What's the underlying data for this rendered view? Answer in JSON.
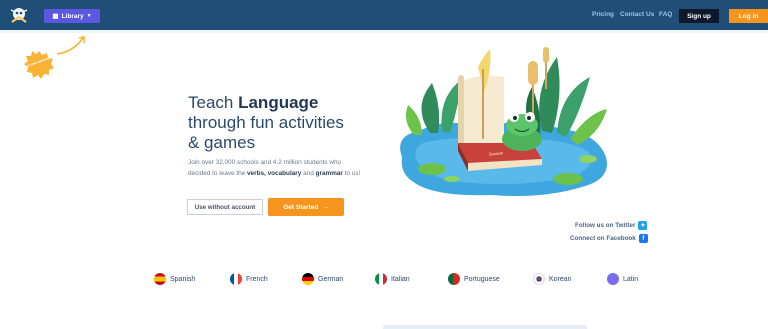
{
  "nav": {
    "library_label": "Library",
    "links": [
      "Pricing",
      "Contact Us",
      "FAQ"
    ],
    "signup_label": "Sign up",
    "login_label": "Log in"
  },
  "badge": {
    "text": "it's a new adventure"
  },
  "hero": {
    "title_pre": "Teach ",
    "title_bold": "Language",
    "title_line2": "through fun activities",
    "title_line3": "& games",
    "sub_part1": "Join over 32,000 schools and 4.2 million students who",
    "sub_part2": "decided to leave the ",
    "sub_verbs": "verbs, vocabulary",
    "sub_and": " and ",
    "sub_grammar": "grammar",
    "sub_end": " to us!",
    "use_without_label": "Use without account",
    "get_started_label": "Get Started",
    "book_label": "Spanish"
  },
  "social": {
    "twitter_label": "Follow us on Twitter",
    "facebook_label": "Connect on Facebook"
  },
  "languages": [
    "Spanish",
    "French",
    "German",
    "Italian",
    "Portuguese",
    "Korean",
    "Latin"
  ],
  "colors": {
    "nav_bg": "#1f4e79",
    "library_btn": "#5b57e0",
    "accent_orange": "#f7941d",
    "signup_bg": "#0e1a2c",
    "title_text": "#2b4a6b"
  }
}
